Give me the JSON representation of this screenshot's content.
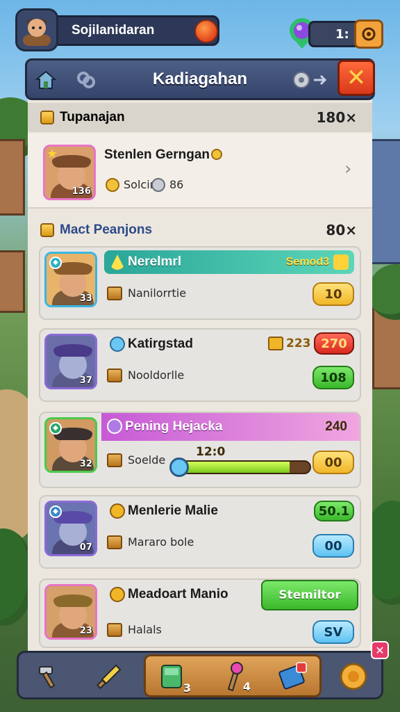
{
  "topbar": {
    "player_name": "Sojilanidaran",
    "resource_value": "1:"
  },
  "panel": {
    "title": "Kadiagahan"
  },
  "section1": {
    "label": "Tupanajan",
    "count": "180×"
  },
  "featured": {
    "name": "Stenlen Gerngan",
    "sub_label": "Solcir",
    "sub_value": "86",
    "level": "136"
  },
  "section2": {
    "label": "Mact Peanjons",
    "count": "80×"
  },
  "cards": [
    {
      "name": "Nerelmrl",
      "tag": "Semod3",
      "sub": "Nanilorrtie",
      "level": "33",
      "pill": "10"
    },
    {
      "name": "Katirgstad",
      "sub": "Nooldorlle",
      "level": "37",
      "amount": "223",
      "red_pill": "270",
      "green_pill": "108"
    },
    {
      "name": "Pening Hejacka",
      "sub": "Soelde",
      "level": "32",
      "amount": "240",
      "progress_label": "12:0",
      "progress": 0.85,
      "pill": "00"
    },
    {
      "name": "Menlerie Malie",
      "sub": "Mararo bole",
      "level": "07",
      "green_pill": "50.1",
      "blue_pill": "00"
    },
    {
      "name": "Meadoart Manio",
      "sub": "Halals",
      "level": "23",
      "button": "Stemiltor",
      "blue_pill": "SV"
    }
  ],
  "bottombar": {
    "count_a": "3",
    "count_b": "4"
  },
  "colors": {
    "accent": "#4d5f86",
    "gold": "#f0b628",
    "green": "#3bb82c",
    "red": "#d92a1e"
  },
  "icons": [
    "home-icon",
    "link-icon",
    "gear-icon",
    "arrow-icon",
    "close-icon",
    "gem-icon",
    "hammer-icon",
    "sword-icon",
    "potion-icon",
    "shield-icon",
    "coin-icon"
  ]
}
